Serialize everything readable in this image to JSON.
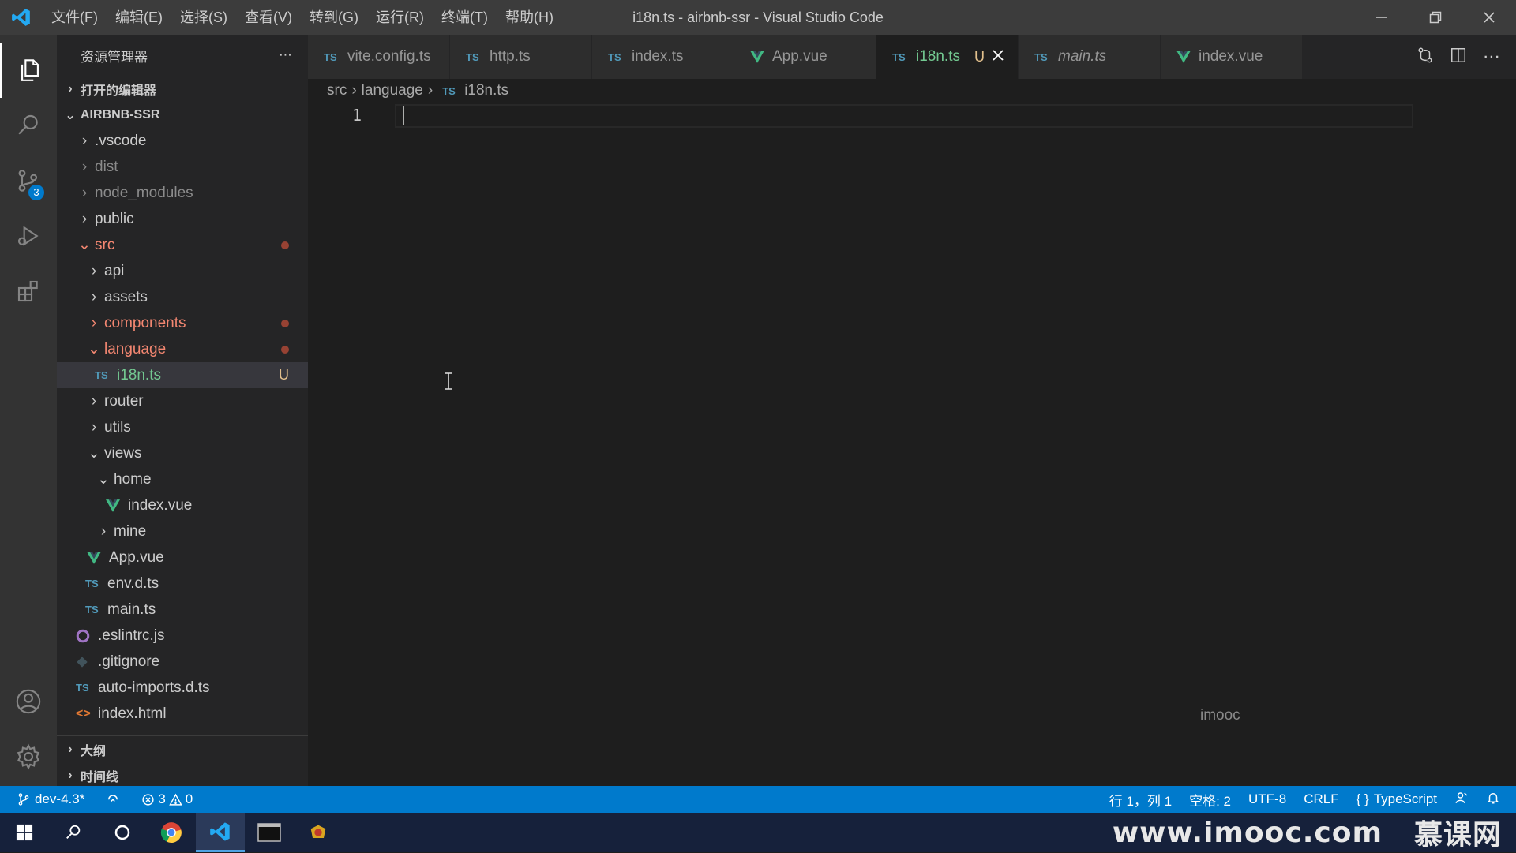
{
  "titlebar": {
    "menu": [
      "文件(F)",
      "编辑(E)",
      "选择(S)",
      "查看(V)",
      "转到(G)",
      "运行(R)",
      "终端(T)",
      "帮助(H)"
    ],
    "title": "i18n.ts - airbnb-ssr - Visual Studio Code"
  },
  "activity": {
    "scm_badge": "3"
  },
  "sidebar": {
    "header": "资源管理器",
    "open_editors": "打开的编辑器",
    "project": "AIRBNB-SSR",
    "files": {
      "vscode": ".vscode",
      "dist": "dist",
      "node_modules": "node_modules",
      "public": "public",
      "src": "src",
      "api": "api",
      "assets": "assets",
      "components": "components",
      "language": "language",
      "i18n": "i18n.ts",
      "i18n_status": "U",
      "router": "router",
      "utils": "utils",
      "views": "views",
      "home": "home",
      "home_index": "index.vue",
      "mine": "mine",
      "app": "App.vue",
      "envd": "env.d.ts",
      "main": "main.ts",
      "eslintrc": ".eslintrc.js",
      "gitignore": ".gitignore",
      "autoimports": "auto-imports.d.ts",
      "indexhtml": "index.html"
    },
    "outline": "大纲",
    "timeline": "时间线"
  },
  "tabs": [
    {
      "label": "vite.config.ts",
      "type": "TS"
    },
    {
      "label": "http.ts",
      "type": "TS"
    },
    {
      "label": "index.ts",
      "type": "TS"
    },
    {
      "label": "App.vue",
      "type": "V"
    },
    {
      "label": "i18n.ts",
      "type": "TS",
      "status": "U"
    },
    {
      "label": "main.ts",
      "type": "TS"
    },
    {
      "label": "index.vue",
      "type": "V"
    }
  ],
  "ts_label": "TS",
  "breadcrumb": {
    "part1": "src",
    "part2": "language",
    "part3": "i18n.ts"
  },
  "editor": {
    "line1": "1",
    "watermark": "imooc"
  },
  "status": {
    "branch": "dev-4.3*",
    "errors": "3",
    "warnings": "0",
    "position": "行 1，列 1",
    "spaces": "空格: 2",
    "encoding": "UTF-8",
    "eol": "CRLF",
    "language": "TypeScript"
  },
  "taskbar": {
    "watermark": "www.imooc.com",
    "brand": "慕课网"
  },
  "colors": {
    "accent": "#007acc",
    "modified": "#e2c08d",
    "ts": "#519aba",
    "vue": "#41b883"
  }
}
